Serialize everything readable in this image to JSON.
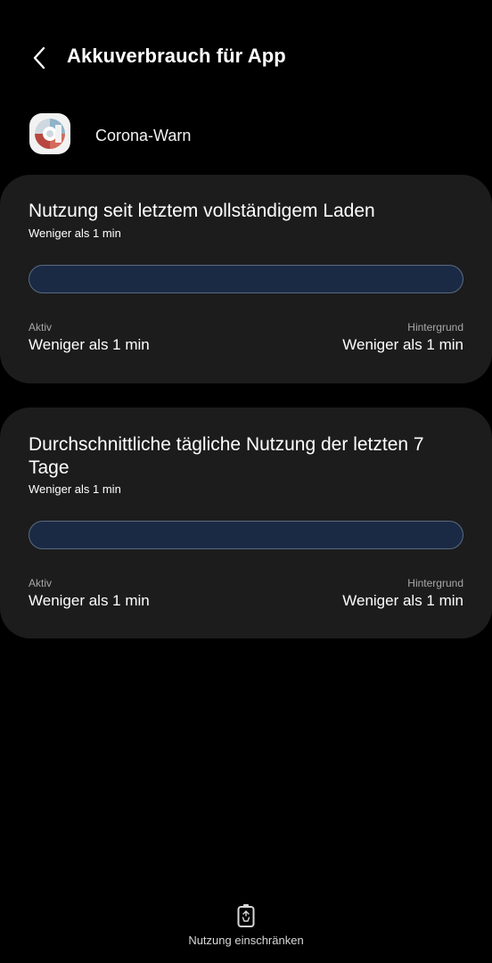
{
  "header": {
    "back_icon": "chevron-left-icon",
    "title": "Akkuverbrauch für App"
  },
  "app": {
    "icon": "corona-warn-app-icon",
    "name": "Corona-Warn"
  },
  "cards": [
    {
      "title": "Nutzung seit letztem vollständigem Laden",
      "subtitle": "Weniger als 1 min",
      "usage_fraction": 0,
      "active_label": "Aktiv",
      "active_value": "Weniger als 1 min",
      "background_label": "Hintergrund",
      "background_value": "Weniger als 1 min"
    },
    {
      "title": "Durchschnittliche tägliche Nutzung der letzten 7 Tage",
      "subtitle": "Weniger als 1 min",
      "usage_fraction": 0,
      "active_label": "Aktiv",
      "active_value": "Weniger als 1 min",
      "background_label": "Hintergrund",
      "background_value": "Weniger als 1 min"
    }
  ],
  "footer": {
    "icon": "battery-restrict-icon",
    "label": "Nutzung einschränken"
  },
  "colors": {
    "background": "#000000",
    "card": "#1c1c1c",
    "bar_track": "#1b2a44",
    "bar_fill": "#2b6fd6"
  }
}
